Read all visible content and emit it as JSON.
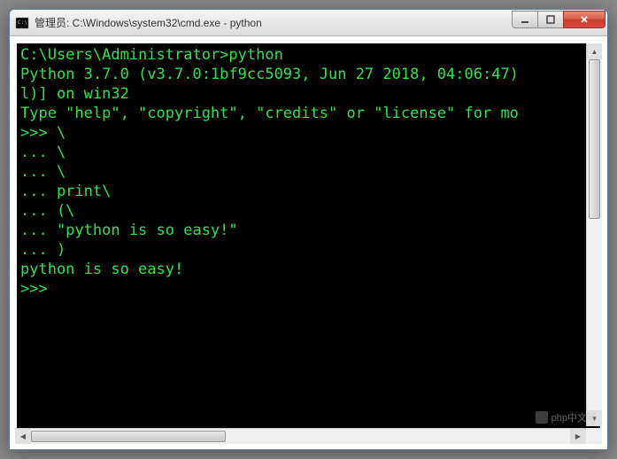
{
  "window": {
    "title": "管理员: C:\\Windows\\system32\\cmd.exe - python"
  },
  "terminal": {
    "lines": [
      "C:\\Users\\Administrator>python",
      "Python 3.7.0 (v3.7.0:1bf9cc5093, Jun 27 2018, 04:06:47)",
      "l)] on win32",
      "Type \"help\", \"copyright\", \"credits\" or \"license\" for mo",
      ">>> \\",
      "... \\",
      "... \\",
      "... print\\",
      "... (\\",
      "... \"python is so easy!\"",
      "... )",
      "python is so easy!",
      ">>>"
    ]
  },
  "watermark": {
    "text": "php中文网"
  }
}
